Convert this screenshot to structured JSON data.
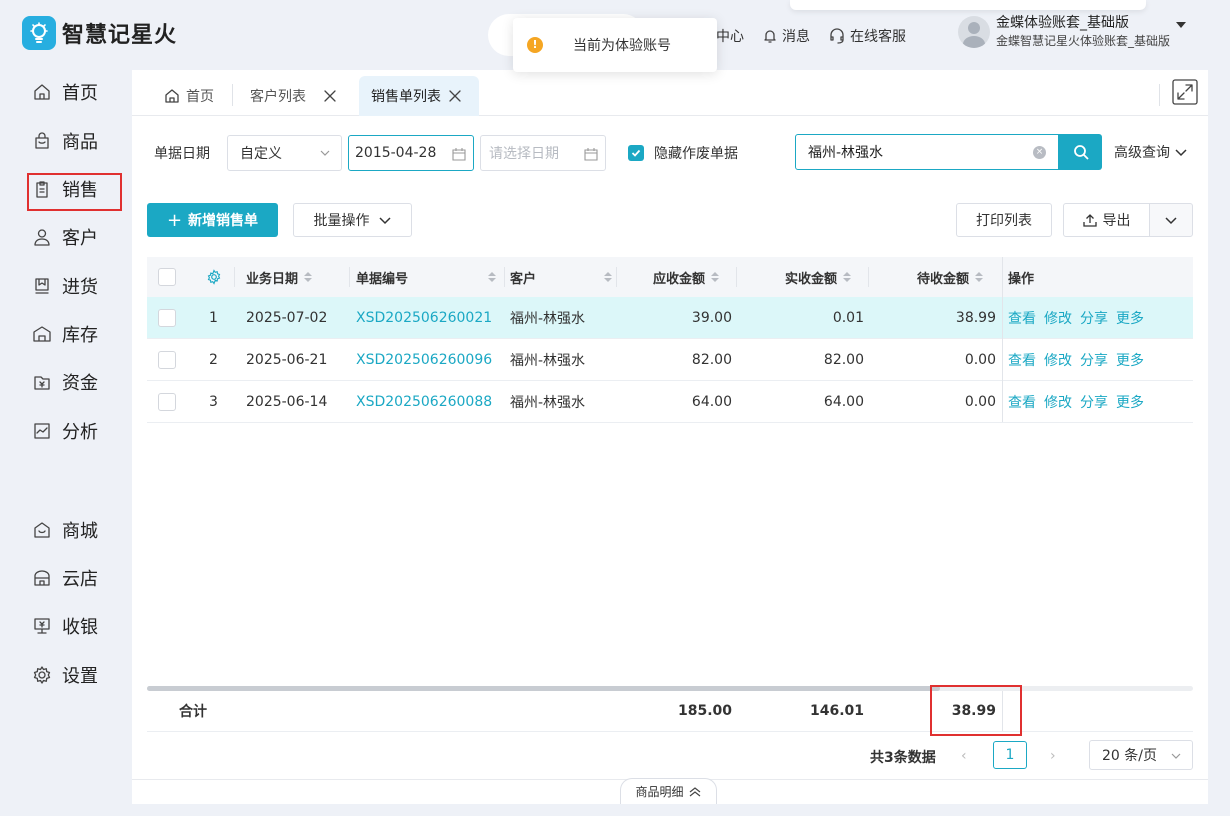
{
  "app": {
    "name": "智慧记星火"
  },
  "topnav": {
    "center_label": "中心",
    "messages_label": "消息",
    "service_label": "在线客服"
  },
  "user": {
    "account": "金蝶体验账套_基础版",
    "subtitle": "金蝶智慧记星火体验账套_基础版"
  },
  "toast": {
    "message": "当前为体验账号"
  },
  "sidebar": {
    "items": [
      {
        "label": "首页",
        "icon": "home-icon"
      },
      {
        "label": "商品",
        "icon": "bag-icon"
      },
      {
        "label": "销售",
        "icon": "clipboard-icon"
      },
      {
        "label": "客户",
        "icon": "person-icon"
      },
      {
        "label": "进货",
        "icon": "purchase-icon"
      },
      {
        "label": "库存",
        "icon": "warehouse-icon"
      },
      {
        "label": "资金",
        "icon": "wallet-icon"
      },
      {
        "label": "分析",
        "icon": "chart-icon"
      },
      {
        "label": "商城",
        "icon": "store-icon"
      },
      {
        "label": "云店",
        "icon": "shop-icon"
      },
      {
        "label": "收银",
        "icon": "cashier-icon"
      },
      {
        "label": "设置",
        "icon": "gear-icon"
      }
    ]
  },
  "tabs": [
    {
      "label": "首页"
    },
    {
      "label": "客户列表"
    },
    {
      "label": "销售单列表"
    }
  ],
  "filter": {
    "date_label": "单据日期",
    "date_mode": "自定义",
    "start_date": "2015-04-28",
    "end_placeholder": "请选择日期",
    "hide_void_label": "隐藏作废单据",
    "search_value": "福州-林强水",
    "advanced_label": "高级查询"
  },
  "toolbar": {
    "add_label": "新增销售单",
    "batch_label": "批量操作",
    "print_label": "打印列表",
    "export_label": "导出"
  },
  "table": {
    "headers": {
      "date": "业务日期",
      "code": "单据编号",
      "customer": "客户",
      "receivable": "应收金额",
      "received": "实收金额",
      "pending": "待收金额",
      "ops": "操作"
    },
    "rows": [
      {
        "idx": "1",
        "date": "2025-07-02",
        "code": "XSD202506260021",
        "customer": "福州-林强水",
        "receivable": "39.00",
        "received": "0.01",
        "pending": "38.99"
      },
      {
        "idx": "2",
        "date": "2025-06-21",
        "code": "XSD202506260096",
        "customer": "福州-林强水",
        "receivable": "82.00",
        "received": "82.00",
        "pending": "0.00"
      },
      {
        "idx": "3",
        "date": "2025-06-14",
        "code": "XSD202506260088",
        "customer": "福州-林强水",
        "receivable": "64.00",
        "received": "64.00",
        "pending": "0.00"
      }
    ],
    "ops": [
      "查看",
      "修改",
      "分享",
      "更多"
    ],
    "summary": {
      "label": "合计",
      "receivable": "185.00",
      "received": "146.01",
      "pending": "38.99"
    }
  },
  "pager": {
    "total_text": "共3条数据",
    "current_page": "1",
    "page_size": "20 条/页"
  },
  "footer": {
    "detail_toggle": "商品明细"
  },
  "colors": {
    "accent": "#1ba8c4",
    "highlight": "#e03030",
    "selected_row": "#dcf7f9"
  }
}
